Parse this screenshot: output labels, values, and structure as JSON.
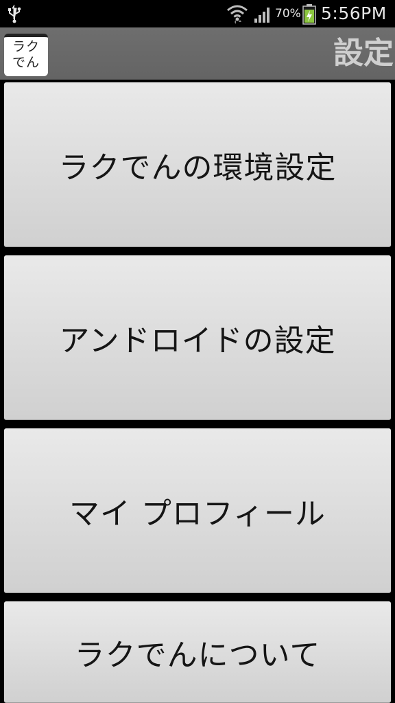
{
  "status_bar": {
    "battery_percent": "70%",
    "time": "5:56PM",
    "icons": [
      "usb-icon",
      "wifi-icon",
      "signal-icon",
      "battery-charging-icon"
    ]
  },
  "action_bar": {
    "app_icon_text": "ラクでん",
    "title": "設定"
  },
  "menu": {
    "items": [
      {
        "label": "ラクでんの環境設定"
      },
      {
        "label": "アンドロイドの設定"
      },
      {
        "label": "マイ プロフィール"
      },
      {
        "label": "ラクでんについて"
      }
    ]
  },
  "colors": {
    "action_bar": "#6b6b6b",
    "button_top": "#e9e9e9",
    "button_bottom": "#d0d0d0",
    "battery_green": "#8cc63f"
  }
}
